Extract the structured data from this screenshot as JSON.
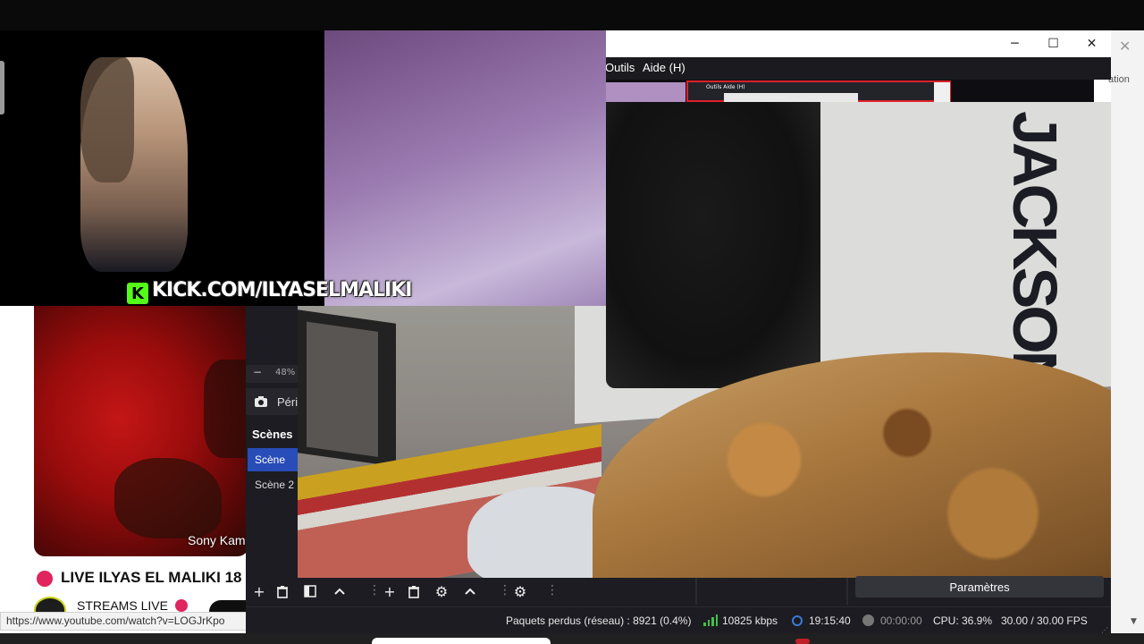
{
  "browser": {
    "status_url": "https://www.youtube.com/watch?v=LOGJrKpo",
    "behind_window_fragment": "ation"
  },
  "youtube_card": {
    "thumbnail_caption": "Sony Kam",
    "video_title": "LIVE ILYAS EL MALIKI 18",
    "channel_name": "STREAMS LIVE"
  },
  "stream_overlay": {
    "banner_text": "KICK.COM/ILYASELMALIKI",
    "logo_letter": "K"
  },
  "obs": {
    "window_controls": {
      "minimize": "─",
      "maximize": "☐",
      "close": "✕"
    },
    "menu": {
      "tools": "Outils",
      "help": "Aide (H)"
    },
    "nested_preview_label": "Outils   Aide (H)",
    "preview_zoom": "48%",
    "source_item_label": "Périphérique de capture vidéo",
    "scenes": {
      "title": "Scènes",
      "items": [
        "Scène",
        "Scène 2"
      ],
      "selected_index": 0
    },
    "settings_button": "Paramètres",
    "status": {
      "dropped_frames": "Paquets perdus (réseau) : 8921 (0.4%)",
      "bitrate": "10825 kbps",
      "stream_time": "19:15:40",
      "record_time": "00:00:00",
      "cpu": "CPU: 36.9%",
      "fps": "30.00 / 30.00 FPS"
    },
    "poster_text": "JACKSON"
  },
  "colors": {
    "obs_bg": "#1c1c22",
    "scene_selected": "#284cb8",
    "kick_green": "#53fc18",
    "live_red": "#e0245e",
    "recording_red": "#e0202a"
  }
}
